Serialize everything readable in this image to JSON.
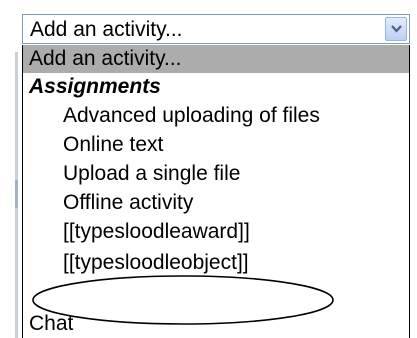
{
  "select": {
    "current_value": "Add an activity...",
    "arrow_icon": "chevron-down-icon"
  },
  "options": {
    "placeholder": "Add an activity...",
    "group_label": "Assignments",
    "advanced_uploading": "Advanced uploading of files",
    "online_text": "Online text",
    "upload_single": "Upload a single file",
    "offline_activity": "Offline activity",
    "typesloodleaward": "[[typesloodleaward]]",
    "typesloodleobject": "[[typesloodleobject]]",
    "chat": "Chat"
  },
  "colors": {
    "selected_row": "#acacac",
    "annotation_stroke": "#000000"
  }
}
